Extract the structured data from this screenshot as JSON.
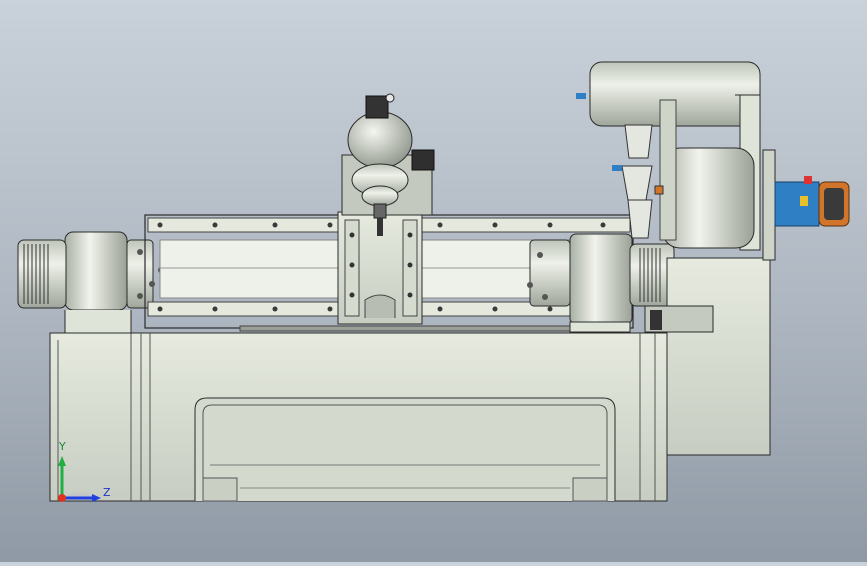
{
  "view": {
    "colors": {
      "background_top": "#c9d1da",
      "background_bottom": "#8f99a5",
      "body": "#dfe4d9",
      "body_shade": "#b9c0b5",
      "outline": "#2a2a2a",
      "accent_blue": "#2f7fc4",
      "accent_orange": "#d0752a"
    }
  },
  "triad": {
    "y_label": "Y",
    "z_label": "Z",
    "x_axis_color": "#e03020",
    "y_axis_color": "#20b040",
    "z_axis_color": "#2040e0"
  }
}
